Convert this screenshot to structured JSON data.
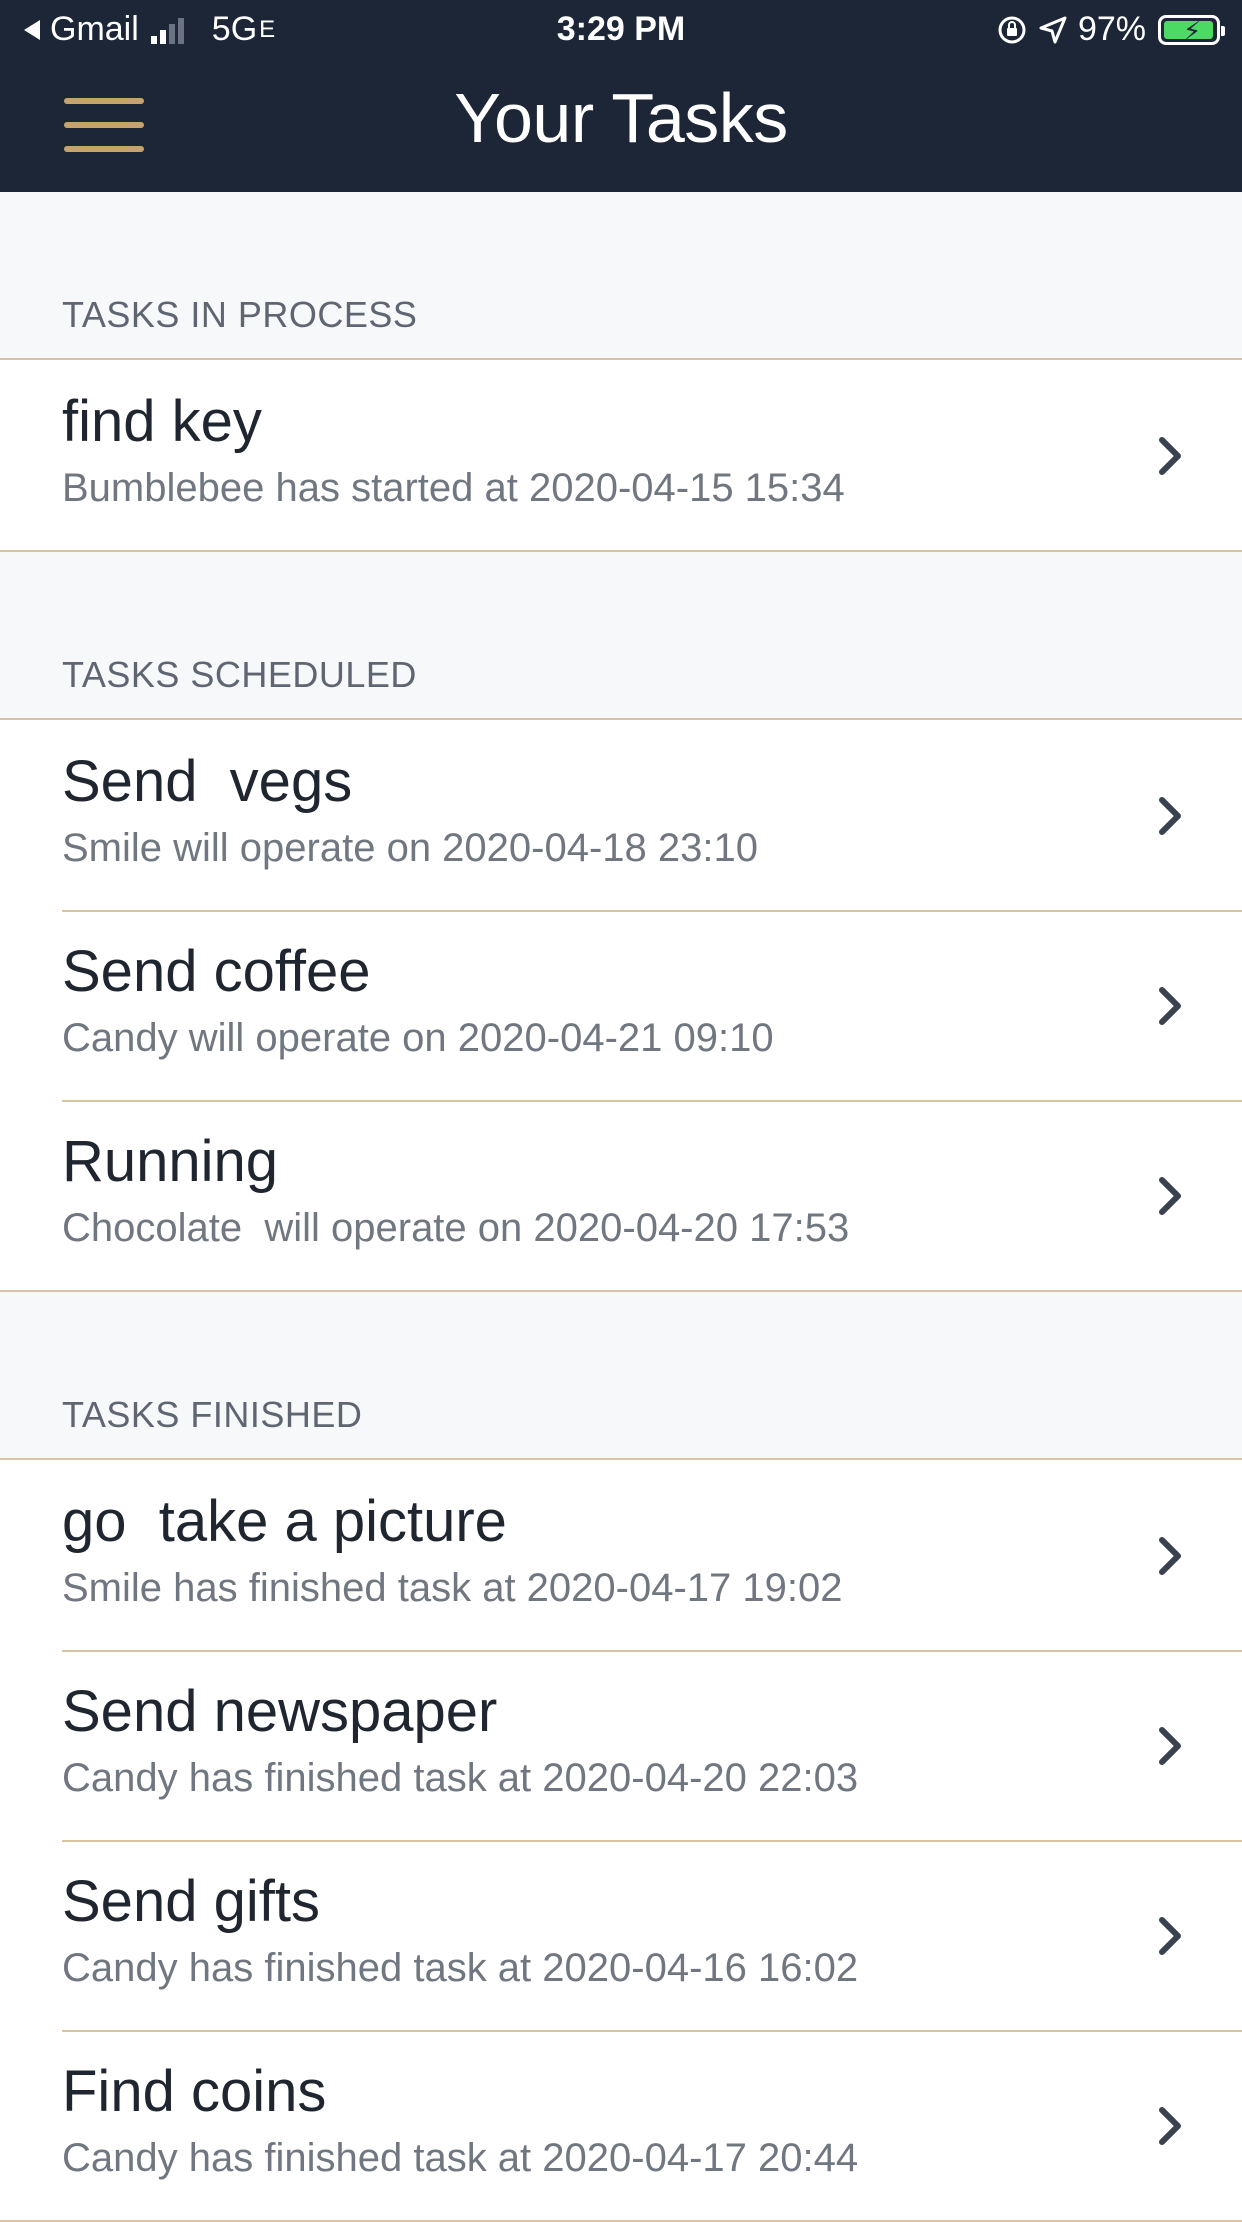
{
  "status_bar": {
    "back_app": "Gmail",
    "network": "5G",
    "network_suffix": "E",
    "time": "3:29 PM",
    "battery": "97%",
    "battery_level": 0.97,
    "battery_color": "#4cd964"
  },
  "nav": {
    "title": "Your Tasks",
    "menu_icon": "hamburger-menu-icon",
    "accent_color": "#c6a46a",
    "bar_color": "#1c2636"
  },
  "sections": [
    {
      "header": "TASKS IN PROCESS",
      "items": [
        {
          "title": "find key",
          "subtitle": "Bumblebee has started at 2020-04-15 15:34"
        }
      ]
    },
    {
      "header": "TASKS SCHEDULED",
      "items": [
        {
          "title": "Send  vegs",
          "subtitle": "Smile will operate on 2020-04-18 23:10"
        },
        {
          "title": "Send coffee",
          "subtitle": "Candy will operate on 2020-04-21 09:10"
        },
        {
          "title": "Running",
          "subtitle": "Chocolate  will operate on 2020-04-20 17:53"
        }
      ]
    },
    {
      "header": "TASKS FINISHED",
      "items": [
        {
          "title": "go  take a picture",
          "subtitle": "Smile has finished task at 2020-04-17 19:02"
        },
        {
          "title": "Send newspaper",
          "subtitle": "Candy has finished task at 2020-04-20 22:03"
        },
        {
          "title": "Send gifts",
          "subtitle": "Candy has finished task at 2020-04-16 16:02"
        },
        {
          "title": "Find coins",
          "subtitle": "Candy has finished task at 2020-04-17 20:44"
        }
      ]
    }
  ]
}
